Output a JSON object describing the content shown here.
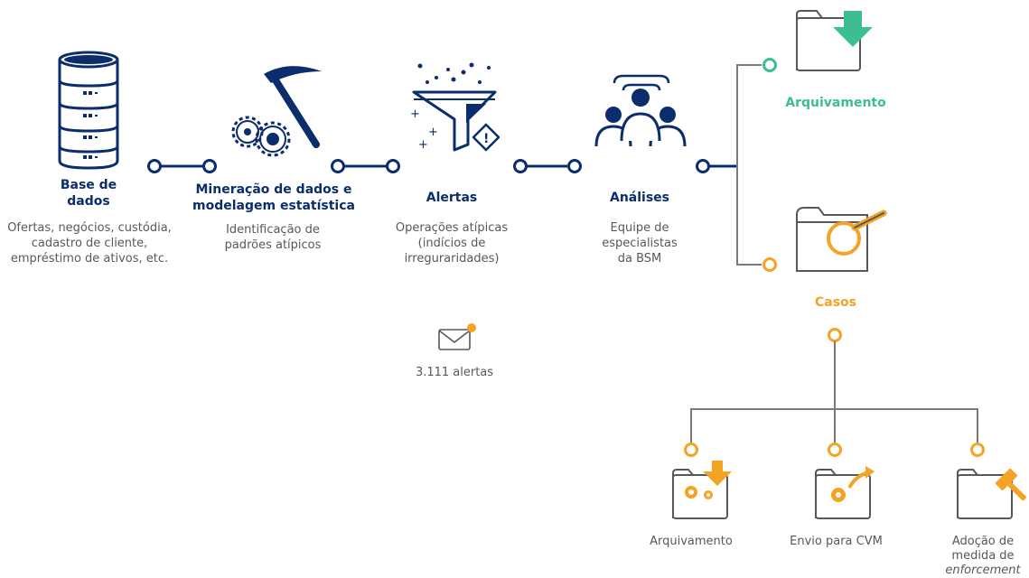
{
  "steps": [
    {
      "title": "Base de dados",
      "title_lines": [
        "Base de",
        "dados"
      ],
      "description": "Ofertas, negócios, custódia, cadastro de cliente, empréstimo de ativos, etc."
    },
    {
      "title": "Mineração de dados e modelagem estatística",
      "title_lines": [
        "Mineração de dados e",
        "modelagem estatística"
      ],
      "description": "Identificação de padrões atípicos"
    },
    {
      "title": "Alertas",
      "description": "Operações atípicas (indícios de irreguraridades)"
    },
    {
      "title": "Análises",
      "description": "Equipe de especialistas da BSM"
    }
  ],
  "alerts_count": "3.111 alertas",
  "outcomes": {
    "archive": "Arquivamento",
    "cases": "Casos"
  },
  "case_outcomes": [
    {
      "label": "Arquivamento"
    },
    {
      "label": "Envio para CVM"
    },
    {
      "label_lines": [
        "Adoção de",
        "medida de"
      ],
      "label_italic": "enforcement"
    }
  ],
  "colors": {
    "navy": "#0b2d6b",
    "green": "#3dbd93",
    "orange": "#f4a324",
    "gray_line": "#7a7a7a",
    "text_gray": "#55585e"
  }
}
